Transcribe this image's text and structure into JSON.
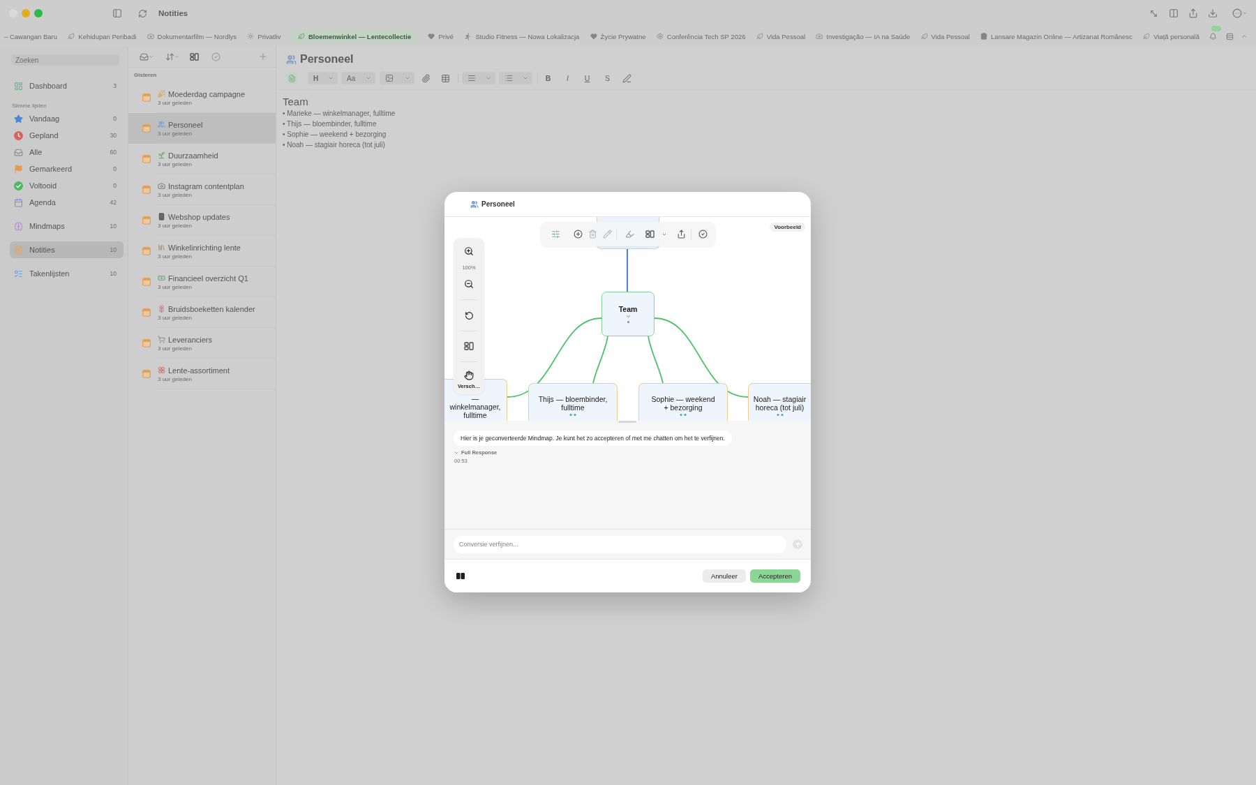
{
  "window": {
    "title": "Notities"
  },
  "tabs": [
    {
      "label": "– Cawangan Baru",
      "selected": false
    },
    {
      "label": "Kehidupan Peribadi",
      "selected": false
    },
    {
      "label": "Dokumentarfilm — Nordlys",
      "selected": false
    },
    {
      "label": "Privatliv",
      "selected": false
    },
    {
      "label": "Bloemenwinkel — Lentecollectie",
      "selected": true
    },
    {
      "label": "Privé",
      "selected": false
    },
    {
      "label": "Studio Fitness — Nowa Lokalizacja",
      "selected": false
    },
    {
      "label": "Życie Prywatne",
      "selected": false
    },
    {
      "label": "Conferência Tech SP 2026",
      "selected": false
    },
    {
      "label": "Vida Pessoal",
      "selected": false
    },
    {
      "label": "Investigação — IA na Saúde",
      "selected": false
    },
    {
      "label": "Vida Pessoal",
      "selected": false
    },
    {
      "label": "Lansare Magazin Online — Artizanat Românesc",
      "selected": false
    },
    {
      "label": "Viață personală",
      "selected": false
    }
  ],
  "sidebar": {
    "search": {
      "placeholder": "Zoeken"
    },
    "sections": [
      {
        "items": [
          {
            "label": "Dashboard",
            "count": "3",
            "selected": false
          }
        ]
      },
      {
        "title": "Slimme lijsten",
        "items": [
          {
            "label": "Vandaag",
            "count": "0",
            "selected": false
          },
          {
            "label": "Gepland",
            "count": "30",
            "selected": false
          },
          {
            "label": "Alle",
            "count": "60",
            "selected": false
          },
          {
            "label": "Gemarkeerd",
            "count": "0",
            "selected": false
          },
          {
            "label": "Voltooid",
            "count": "0",
            "selected": false
          },
          {
            "label": "Agenda",
            "count": "42",
            "selected": false
          }
        ]
      },
      {
        "items": [
          {
            "label": "Mindmaps",
            "count": "10",
            "selected": false
          }
        ]
      },
      {
        "items": [
          {
            "label": "Notities",
            "count": "10",
            "selected": true
          }
        ]
      },
      {
        "items": [
          {
            "label": "Takenlijsten",
            "count": "10",
            "selected": false
          }
        ]
      }
    ]
  },
  "note_list": {
    "group": "Gisteren",
    "notes": [
      {
        "title": "Moederdag campagne",
        "time": "3 uur geleden",
        "selected": false
      },
      {
        "title": "Personeel",
        "time": "3 uur geleden",
        "selected": true
      },
      {
        "title": "Duurzaamheid",
        "time": "3 uur geleden",
        "selected": false
      },
      {
        "title": "Instagram contentplan",
        "time": "3 uur geleden",
        "selected": false
      },
      {
        "title": "Webshop updates",
        "time": "3 uur geleden",
        "selected": false
      },
      {
        "title": "Winkelinrichting lente",
        "time": "3 uur geleden",
        "selected": false
      },
      {
        "title": "Financieel overzicht Q1",
        "time": "3 uur geleden",
        "selected": false
      },
      {
        "title": "Bruidsboeketten kalender",
        "time": "3 uur geleden",
        "selected": false
      },
      {
        "title": "Leveranciers",
        "time": "3 uur geleden",
        "selected": false
      },
      {
        "title": "Lente-assortiment",
        "time": "3 uur geleden",
        "selected": false
      }
    ]
  },
  "editor": {
    "title": "Personeel",
    "toolbar": {
      "heading": "H",
      "font": "Aa",
      "styles": [
        "B",
        "I",
        "U",
        "S"
      ]
    },
    "content": {
      "heading": "Team",
      "lines": [
        "• Marieke — winkelmanager, fulltime",
        "• Thijs — bloembinder, fulltime",
        "• Sophie — weekend + bezorging",
        "• Noah — stagiair horeca (tot juli)"
      ]
    }
  },
  "dialog": {
    "title": "Personeel",
    "badge": "Voorbeeld",
    "zoom": {
      "zoom_text": "100%",
      "pan_label": "Versch…"
    },
    "mindmap": {
      "root": {
        "children": [
          {
            "label": "Team",
            "expanded": true,
            "children": [
              {
                "label": "— winkelmanager, fulltime"
              },
              {
                "label": "Thijs — bloembinder, fulltime"
              },
              {
                "label": "Sophie — weekend + bezorging"
              },
              {
                "label": "Noah — stagiair horeca (tot juli)"
              }
            ]
          }
        ]
      }
    },
    "chat": {
      "message": "Hier is je geconverteerde Mindmap. Je kunt het zo accepteren of met me chatten om het te verfijnen.",
      "response": {
        "label": "Full Response",
        "time": "00:53"
      }
    },
    "input": {
      "placeholder": "Conversie verfijnen..."
    },
    "buttons": [
      {
        "label": "Annuleer",
        "kind": "secondary"
      },
      {
        "label": "Accepteren",
        "kind": "primary"
      }
    ]
  }
}
